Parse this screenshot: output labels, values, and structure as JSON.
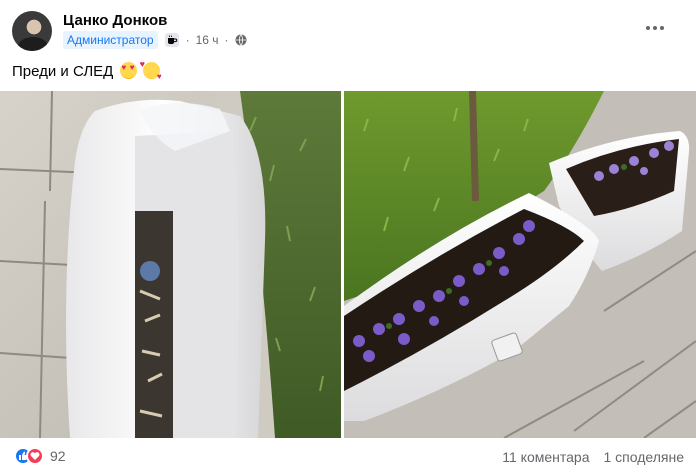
{
  "post": {
    "author": "Цанко Донков",
    "role_badge": "Администратор",
    "time": "16 ч",
    "separator": "·",
    "text": "Преди и СЛЕД",
    "emojis": [
      "smiling-face-with-heart-eyes",
      "smiling-face-with-hearts"
    ],
    "icons": {
      "role_icon": "coffee-cup-icon",
      "privacy_icon": "globe-icon",
      "menu_icon": "more-options-icon"
    }
  },
  "photos": [
    {
      "name": "before-photo",
      "subject": "empty white planter with cigarette butts"
    },
    {
      "name": "after-photo",
      "subject": "white planters with purple petunias"
    }
  ],
  "footer": {
    "reaction_count": "92",
    "reactions": [
      "like",
      "love"
    ],
    "comments": "11 коментара",
    "shares": "1 споделяне"
  },
  "colors": {
    "facebook_blue": "#1877f2",
    "love_red": "#f33e58",
    "secondary_text": "#65676b",
    "petunia_purple": "#7a5bc7"
  }
}
